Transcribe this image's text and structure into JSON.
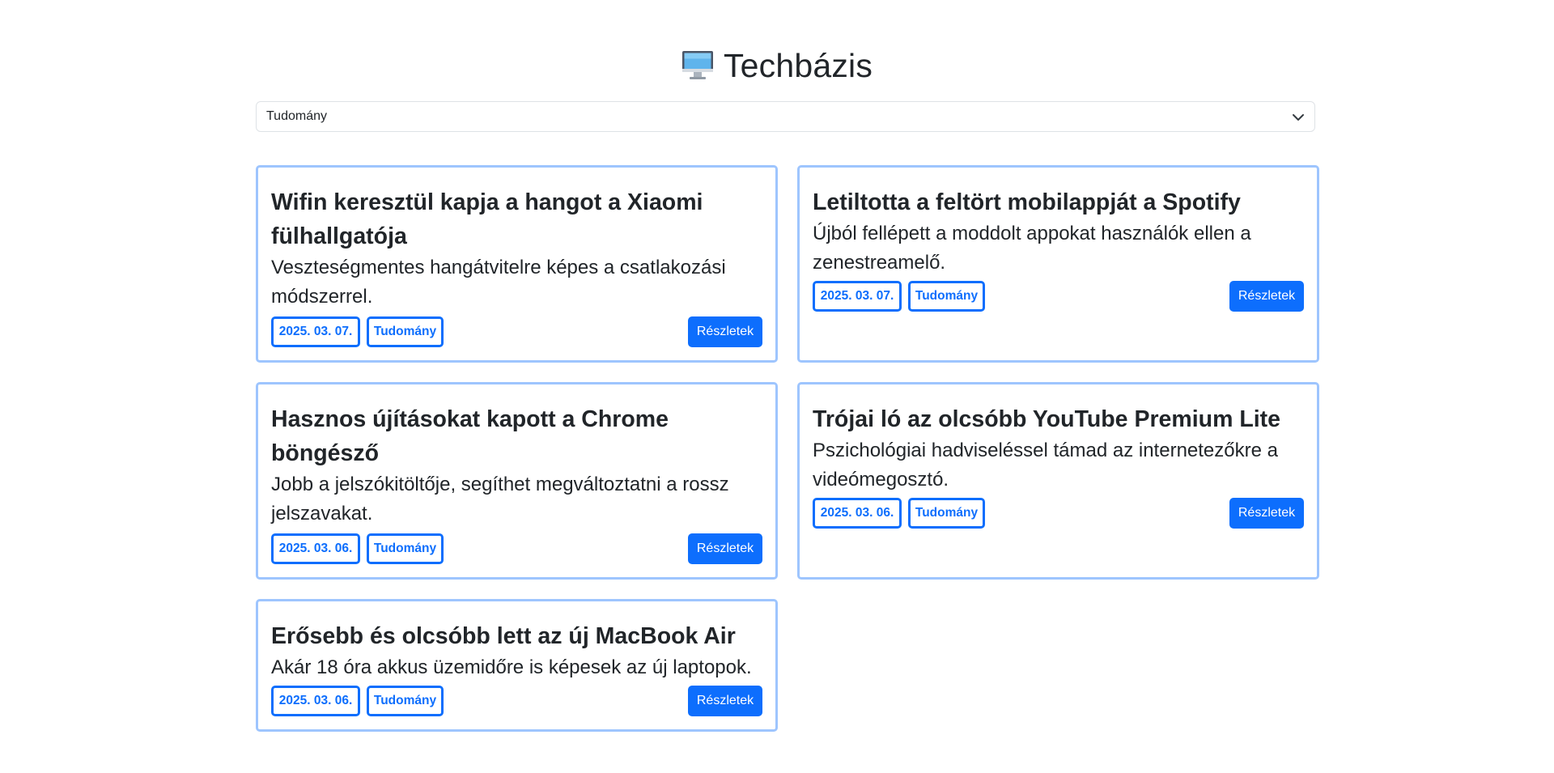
{
  "header": {
    "logo_icon": "desktop-computer-icon",
    "title": "Techbázis"
  },
  "category_select": {
    "selected": "Tudomány",
    "icon": "chevron-down-icon"
  },
  "colors": {
    "accent": "#0d6efd",
    "card_border": "#9ec5fe",
    "text": "#212529"
  },
  "articles": [
    {
      "title": "Wifin keresztül kapja a hangot a Xiaomi fülhallgatója",
      "summary": "Veszteségmentes hangátvitelre képes a csatlakozási módszerrel.",
      "date": "2025. 03. 07.",
      "category": "Tudomány",
      "button": "Részletek"
    },
    {
      "title": "Letiltotta a feltört mobilappját a Spotify",
      "summary": "Újból fellépett a moddolt appokat használók ellen a zenestreamelő.",
      "date": "2025. 03. 07.",
      "category": "Tudomány",
      "button": "Részletek"
    },
    {
      "title": "Hasznos újításokat kapott a Chrome böngésző",
      "summary": "Jobb a jelszókitöltője, segíthet megváltoztatni a rossz jelszavakat.",
      "date": "2025. 03. 06.",
      "category": "Tudomány",
      "button": "Részletek"
    },
    {
      "title": "Trójai ló az olcsóbb YouTube Premium Lite",
      "summary": "Pszichológiai hadviseléssel támad az internetezőkre a videómegosztó.",
      "date": "2025. 03. 06.",
      "category": "Tudomány",
      "button": "Részletek"
    },
    {
      "title": "Erősebb és olcsóbb lett az új MacBook Air",
      "summary": "Akár 18 óra akkus üzemidőre is képesek az új laptopok.",
      "date": "2025. 03. 06.",
      "category": "Tudomány",
      "button": "Részletek"
    }
  ]
}
